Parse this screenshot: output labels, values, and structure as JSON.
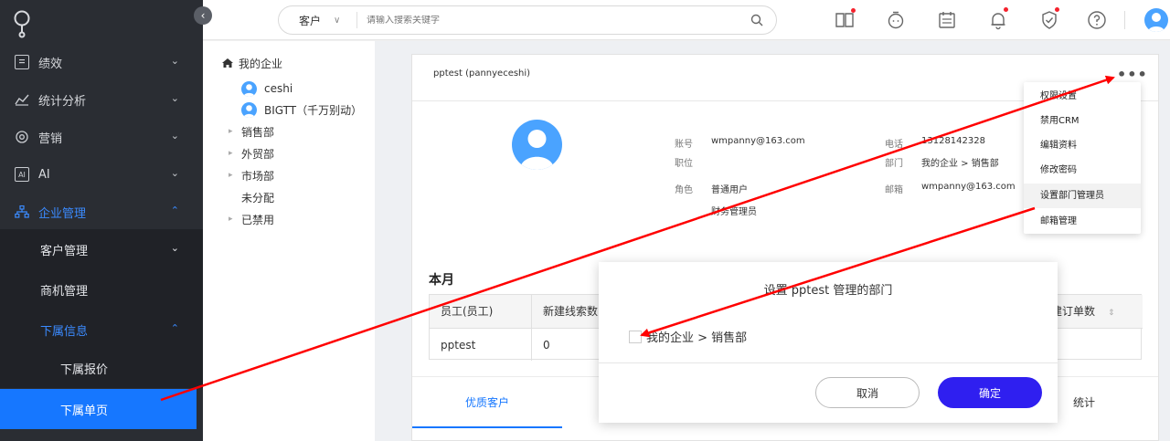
{
  "sidebar": {
    "items": [
      {
        "label": "绩效",
        "icon": "chart-box-icon"
      },
      {
        "label": "统计分析",
        "icon": "line-chart-icon"
      },
      {
        "label": "营销",
        "icon": "target-icon"
      },
      {
        "label": "AI",
        "icon": "ai-icon"
      },
      {
        "label": "企业管理",
        "icon": "org-tree-icon"
      }
    ],
    "sub_items": [
      {
        "label": "客户管理"
      },
      {
        "label": "商机管理"
      },
      {
        "label": "下属信息"
      },
      {
        "label": "下属报价"
      },
      {
        "label": "下属单页"
      }
    ],
    "ai_icon_text": "AI"
  },
  "topbar": {
    "search_type": "客户",
    "search_placeholder": "请输入搜索关键字"
  },
  "tree": {
    "root": "我的企业",
    "users": [
      "ceshi",
      "BIGTT（千万别动）"
    ],
    "departments": [
      "销售部",
      "外贸部",
      "市场部",
      "未分配",
      "已禁用"
    ]
  },
  "profile": {
    "title": "pptest (pannyeceshi)",
    "account_label": "账号",
    "account_value": "wmpanny@163.com",
    "position_label": "职位",
    "role_label": "角色",
    "role_values": [
      "普通用户",
      "财务管理员"
    ],
    "phone_label": "电话",
    "phone_value": "13128142328",
    "dept_label": "部门",
    "dept_value": "我的企业 > 销售部",
    "email_label": "邮箱",
    "email_value": "wmpanny@163.com"
  },
  "dropdown": {
    "items": [
      "权限设置",
      "禁用CRM",
      "编辑资料",
      "修改密码",
      "设置部门管理员",
      "邮箱管理"
    ]
  },
  "stats": {
    "section_title": "本月",
    "headers": [
      "员工(员工)",
      "新建线索数",
      "建订单数"
    ],
    "row": [
      "pptest",
      "0"
    ]
  },
  "tabs": [
    "优质客户",
    "统计"
  ],
  "modal": {
    "title": "设置 pptest 管理的部门",
    "option": "我的企业 > 销售部",
    "cancel": "取消",
    "ok": "确定"
  },
  "colors": {
    "sidebar_bg": "#2a2d33",
    "accent": "#1677ff",
    "primary_button": "#2f1ff0",
    "annotation_arrow": "#ff0000"
  }
}
